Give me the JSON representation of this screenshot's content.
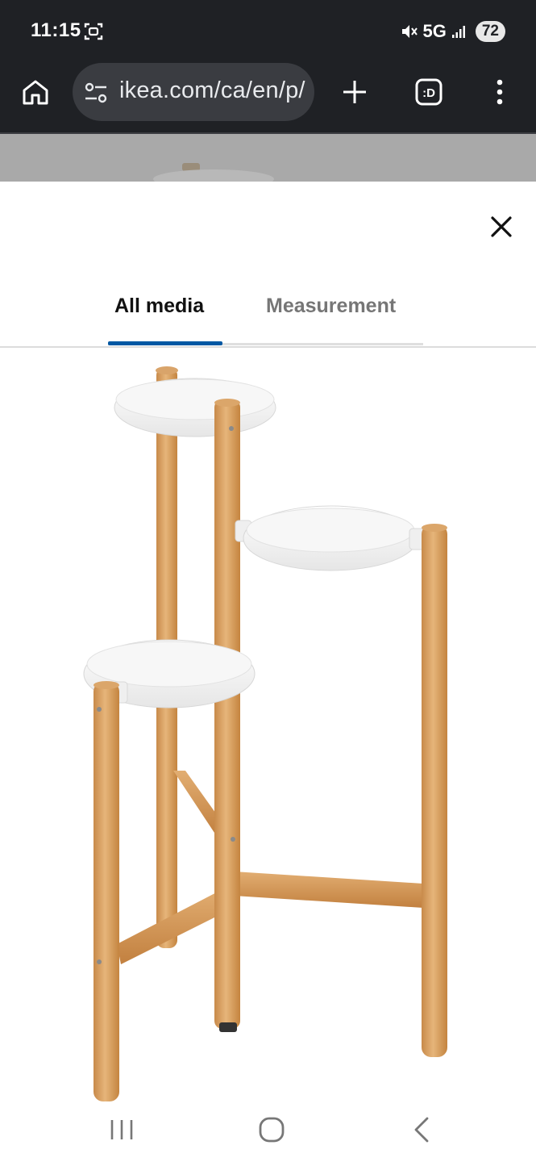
{
  "status_bar": {
    "time": "11:15",
    "network": "5G",
    "battery": "72"
  },
  "browser": {
    "url": "ikea.com/ca/en/p/"
  },
  "media_viewer": {
    "tabs": [
      {
        "label": "All media",
        "active": true
      },
      {
        "label": "Measurement",
        "active": false
      }
    ],
    "accent_color": "#0058a3"
  },
  "icons": {
    "status": [
      "screen-capture-icon",
      "mute-icon",
      "signal-icon"
    ],
    "browser": [
      "home-icon",
      "site-settings-icon",
      "new-tab-icon",
      "tab-switcher-icon",
      "more-menu-icon"
    ],
    "sheet": [
      "close-icon"
    ],
    "nav": [
      "recents-icon",
      "home-icon",
      "back-icon"
    ]
  }
}
